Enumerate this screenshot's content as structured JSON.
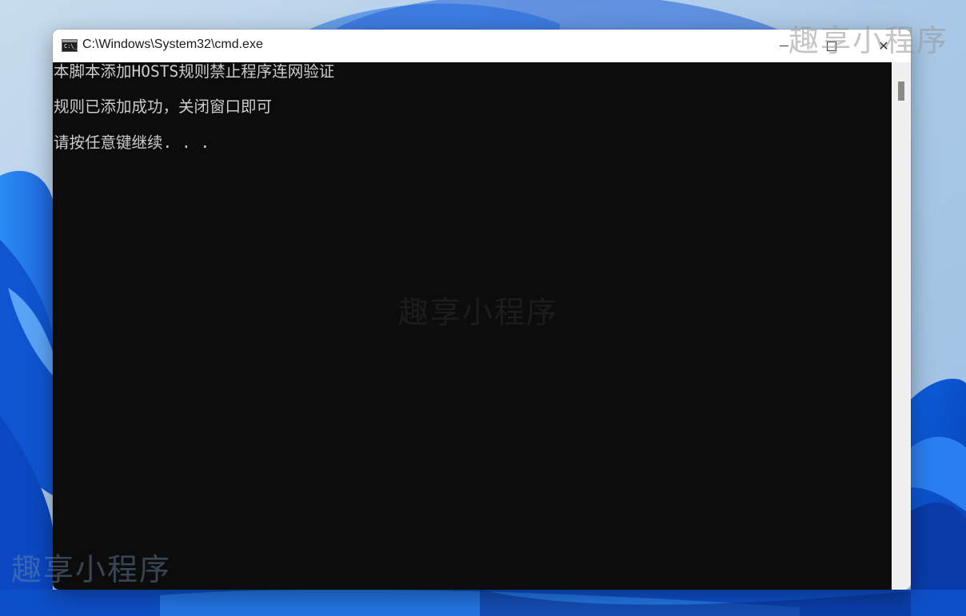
{
  "window": {
    "title": "C:\\Windows\\System32\\cmd.exe",
    "icon": "cmd-icon",
    "icon_prompt": "C:\\_",
    "controls": {
      "minimize": "minimize-icon",
      "maximize": "maximize-icon",
      "close": "close-icon",
      "close_glyph": "✕"
    }
  },
  "console": {
    "background": "#0c0c0c",
    "text_color": "#cccccc",
    "lines": [
      "本脚本添加HOSTS规则禁止程序连网验证",
      "规则已添加成功，关闭窗口即可",
      "请按任意键继续. . ."
    ]
  },
  "watermark": {
    "text": "趣享小程序"
  },
  "desktop": {
    "wallpaper": "windows-11-bloom",
    "accent": "#1a6fe0"
  }
}
